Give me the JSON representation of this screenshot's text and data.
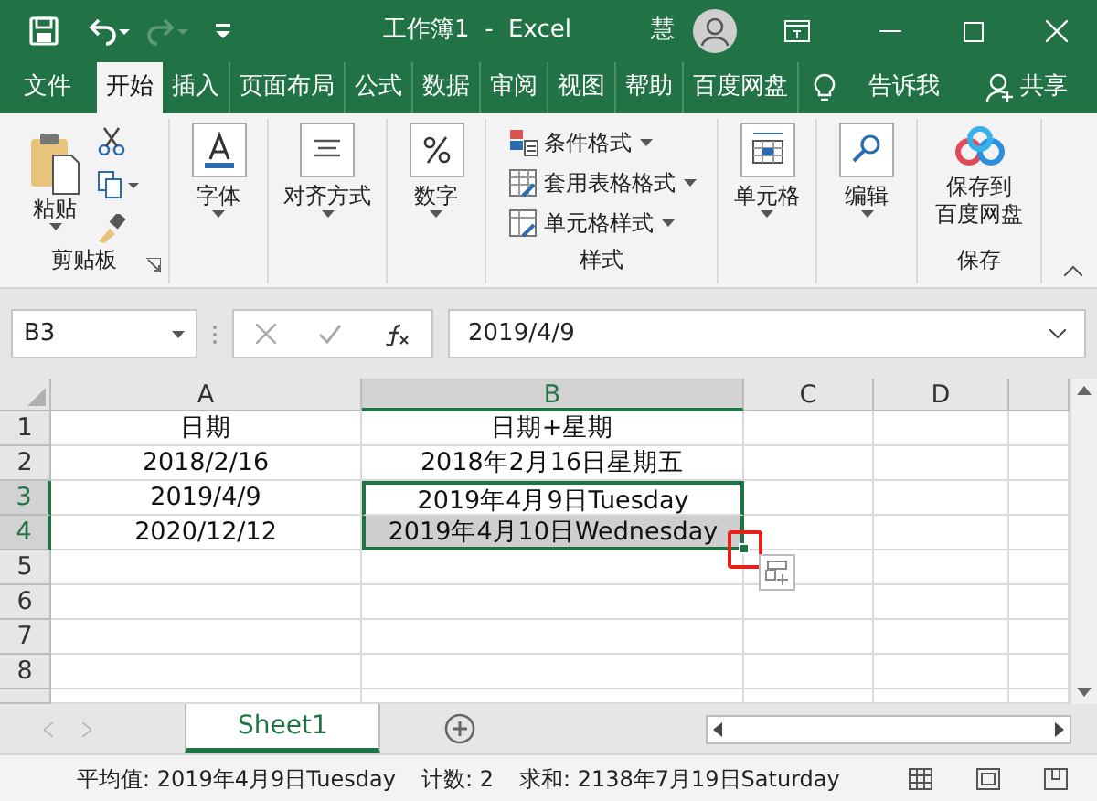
{
  "title_bar": {
    "title": "工作簿1  -  Excel",
    "user": "慧"
  },
  "tabs": [
    {
      "label": "文件",
      "selected": false
    },
    {
      "label": "开始",
      "selected": true
    },
    {
      "label": "插入",
      "selected": false
    },
    {
      "label": "页面布局",
      "selected": false
    },
    {
      "label": "公式",
      "selected": false
    },
    {
      "label": "数据",
      "selected": false
    },
    {
      "label": "审阅",
      "selected": false
    },
    {
      "label": "视图",
      "selected": false
    },
    {
      "label": "帮助",
      "selected": false
    },
    {
      "label": "百度网盘",
      "selected": false
    }
  ],
  "tell_me": "告诉我",
  "share": "共享",
  "ribbon": {
    "clipboard": {
      "paste": "粘贴",
      "label": "剪贴板"
    },
    "font": "字体",
    "alignment": "对齐方式",
    "number": "数字",
    "styles": {
      "items": [
        "条件格式",
        "套用表格格式",
        "单元格样式"
      ],
      "label": "样式"
    },
    "cells": "单元格",
    "editing": "编辑",
    "save": {
      "button": [
        "保存到",
        "百度网盘"
      ],
      "label": "保存"
    }
  },
  "formula_bar": {
    "name_box": "B3",
    "formula": "2019/4/9"
  },
  "columns": [
    {
      "label": "A",
      "selected": false
    },
    {
      "label": "B",
      "selected": true
    },
    {
      "label": "C",
      "selected": false
    },
    {
      "label": "D",
      "selected": false
    }
  ],
  "rows": [
    {
      "header": "1",
      "selected": false,
      "cells": [
        {
          "text": "日期",
          "selected": false
        },
        {
          "text": "日期+星期",
          "selected": false
        }
      ]
    },
    {
      "header": "2",
      "selected": false,
      "cells": [
        {
          "text": "2018/2/16",
          "selected": false
        },
        {
          "text": "2018年2月16日星期五",
          "selected": false
        }
      ]
    },
    {
      "header": "3",
      "selected": true,
      "cells": [
        {
          "text": "2019/4/9",
          "selected": false
        },
        {
          "text": "2019年4月9日Tuesday",
          "selected": true
        }
      ]
    },
    {
      "header": "4",
      "selected": true,
      "cells": [
        {
          "text": "2020/12/12",
          "selected": false
        },
        {
          "text": "2019年4月10日Wednesday",
          "selected": true
        }
      ]
    },
    {
      "header": "5",
      "selected": false,
      "cells": []
    },
    {
      "header": "6",
      "selected": false,
      "cells": []
    },
    {
      "header": "7",
      "selected": false,
      "cells": []
    },
    {
      "header": "8",
      "selected": false,
      "cells": []
    }
  ],
  "sheet_tabs": [
    {
      "label": "Sheet1",
      "selected": true
    }
  ],
  "status_bar": [
    "平均值: 2019年4月9日Tuesday",
    "计数: 2",
    "求和: 2138年7月19日Saturday"
  ]
}
